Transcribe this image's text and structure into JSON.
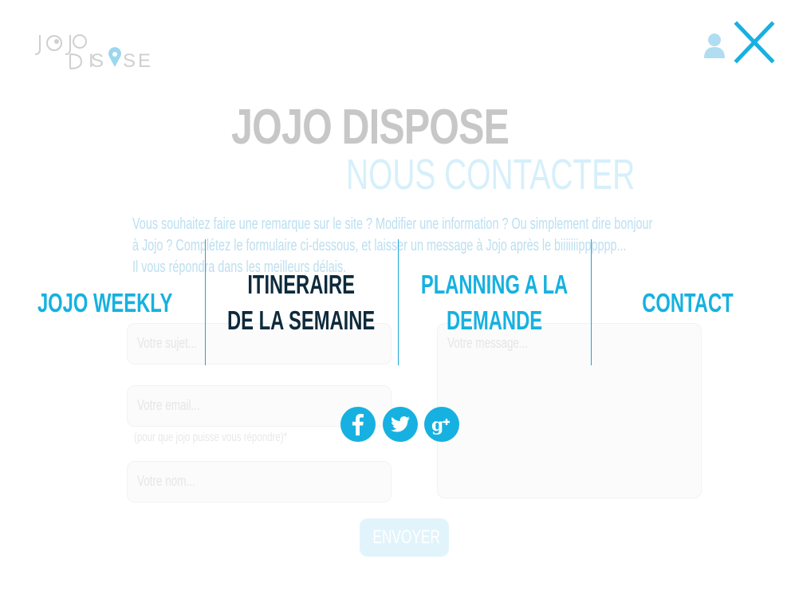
{
  "logo": {
    "text": "JOJO DISPOSE"
  },
  "header": {
    "user_icon": "user-icon",
    "close_label": "X"
  },
  "background": {
    "title": "JOJO DISPOSE",
    "subtitle": "NOUS CONTACTER",
    "intro_lines": [
      "Vous souhaitez faire une remarque sur le site ? Modifier une information ? Ou simplement dire bonjour",
      "à Jojo ? Complétez le formulaire ci-dessous, et laisser un message à Jojo après le biiiiiiipppppp...",
      "Il vous répondra dans les meilleurs délais."
    ],
    "form": {
      "subject_placeholder": "Votre sujet...",
      "email_placeholder": "Votre email...",
      "email_note": "(pour que jojo puisse vous répondre)*",
      "name_placeholder": "Votre nom...",
      "message_placeholder": "Votre message...",
      "submit_label": "ENVOYER"
    }
  },
  "menu": {
    "items": [
      {
        "line1": "JOJO WEEKLY",
        "line2": "",
        "active": false
      },
      {
        "line1": "ITINERAIRE",
        "line2": "DE LA SEMAINE",
        "active": true
      },
      {
        "line1": "PLANNING A LA",
        "line2": "DEMANDE",
        "active": false
      },
      {
        "line1": "CONTACT",
        "line2": "",
        "active": false
      }
    ]
  },
  "social": {
    "icons": [
      "facebook-icon",
      "twitter-icon",
      "google-plus-icon"
    ]
  },
  "colors": {
    "accent": "#16b1e0",
    "active_menu": "#0e2a3b",
    "faded_gray": "#c7c7c7"
  }
}
